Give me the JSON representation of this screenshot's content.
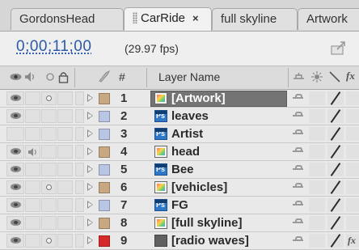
{
  "tabs": [
    {
      "label": "GordonsHead",
      "active": false
    },
    {
      "label": "CarRide",
      "active": true,
      "close": "×"
    },
    {
      "label": "full skyline",
      "active": false
    },
    {
      "label": "Artwork",
      "active": false
    }
  ],
  "timecode": "0;00;11;00",
  "fps": "(29.97 fps)",
  "header": {
    "num": "#",
    "layer_name": "Layer Name",
    "fx": "fx"
  },
  "layers": [
    {
      "num": "1",
      "name": "[Artwork]",
      "icon": "comp-icon",
      "label_color": "#c8a883",
      "eye": true,
      "audio": false,
      "solo": true,
      "selected": true,
      "fx": false
    },
    {
      "num": "2",
      "name": "leaves",
      "icon": "photoshop-icon",
      "label_color": "#b8c6e4",
      "eye": true,
      "audio": false,
      "solo": false,
      "selected": false,
      "fx": false
    },
    {
      "num": "3",
      "name": "Artist",
      "icon": "photoshop-icon",
      "label_color": "#b8c6e4",
      "eye": false,
      "audio": false,
      "solo": false,
      "selected": false,
      "fx": false
    },
    {
      "num": "4",
      "name": "head",
      "icon": "comp-icon",
      "label_color": "#c8a883",
      "eye": true,
      "audio": true,
      "solo": false,
      "selected": false,
      "fx": false
    },
    {
      "num": "5",
      "name": "Bee",
      "icon": "photoshop-icon",
      "label_color": "#b8c6e4",
      "eye": true,
      "audio": false,
      "solo": false,
      "selected": false,
      "fx": false
    },
    {
      "num": "6",
      "name": "[vehicles]",
      "icon": "comp-icon",
      "label_color": "#c8a883",
      "eye": true,
      "audio": false,
      "solo": true,
      "selected": false,
      "fx": false
    },
    {
      "num": "7",
      "name": "FG",
      "icon": "photoshop-icon",
      "label_color": "#b8c6e4",
      "eye": true,
      "audio": false,
      "solo": false,
      "selected": false,
      "fx": false
    },
    {
      "num": "8",
      "name": "[full skyline]",
      "icon": "comp-icon",
      "label_color": "#c8a883",
      "eye": true,
      "audio": false,
      "solo": false,
      "selected": false,
      "fx": false
    },
    {
      "num": "9",
      "name": "[radio waves]",
      "icon": "solid-icon",
      "label_color": "#d42a2a",
      "eye": true,
      "audio": false,
      "solo": true,
      "selected": false,
      "fx": true
    }
  ]
}
